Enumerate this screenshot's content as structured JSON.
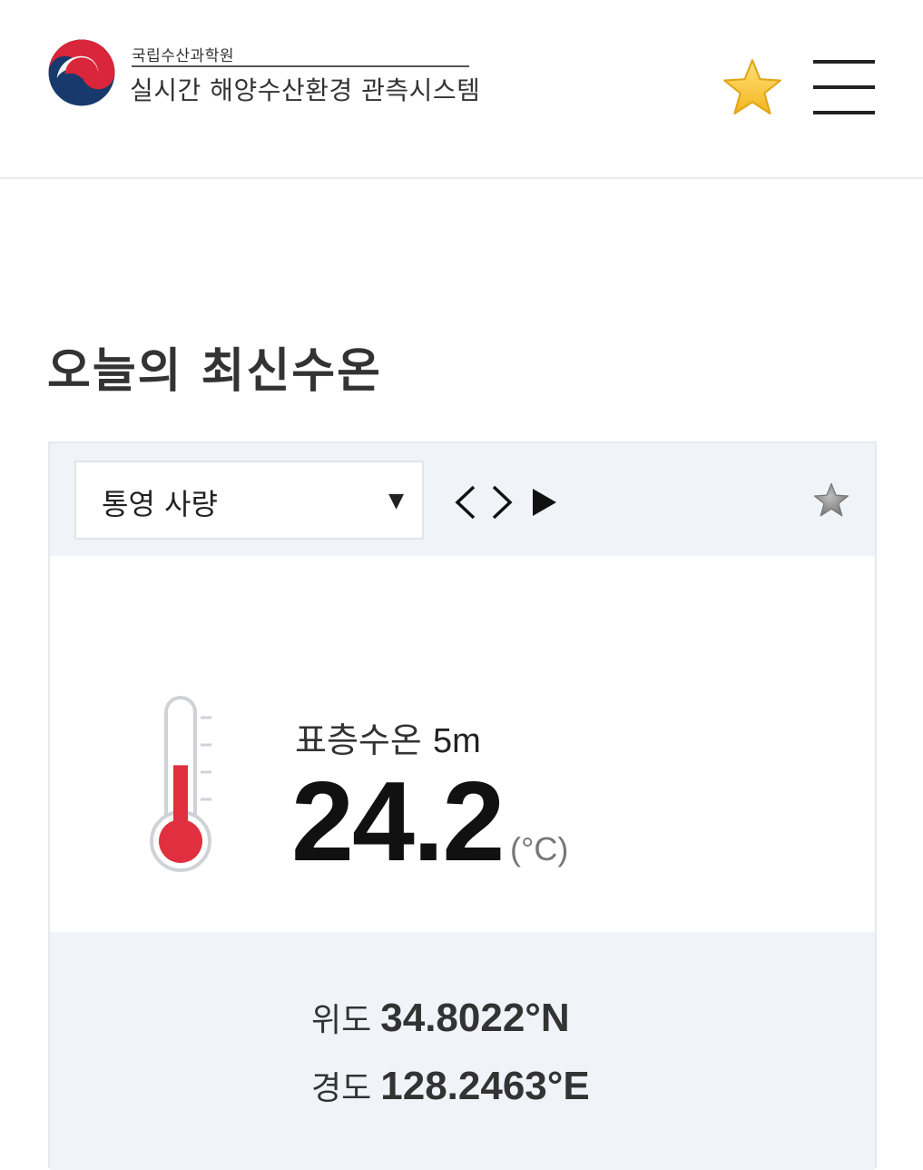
{
  "header": {
    "org_name": "국립수산과학원",
    "system_name": "실시간 해양수산환경 관측시스템"
  },
  "page_title": "오늘의 최신수온",
  "station_select": {
    "selected": "통영 사량"
  },
  "reading": {
    "label": "표층수온",
    "depth": "5m",
    "value": "24.2",
    "unit": "(°C)",
    "thermometer_level": 0.55
  },
  "location": {
    "lat_label": "위도",
    "lat_value": "34.8022°N",
    "lon_label": "경도",
    "lon_value": "128.2463°E"
  },
  "colors": {
    "accent_star": "#f7c531",
    "thermo_red": "#e0303f",
    "panel_bg": "#f0f4f9"
  }
}
